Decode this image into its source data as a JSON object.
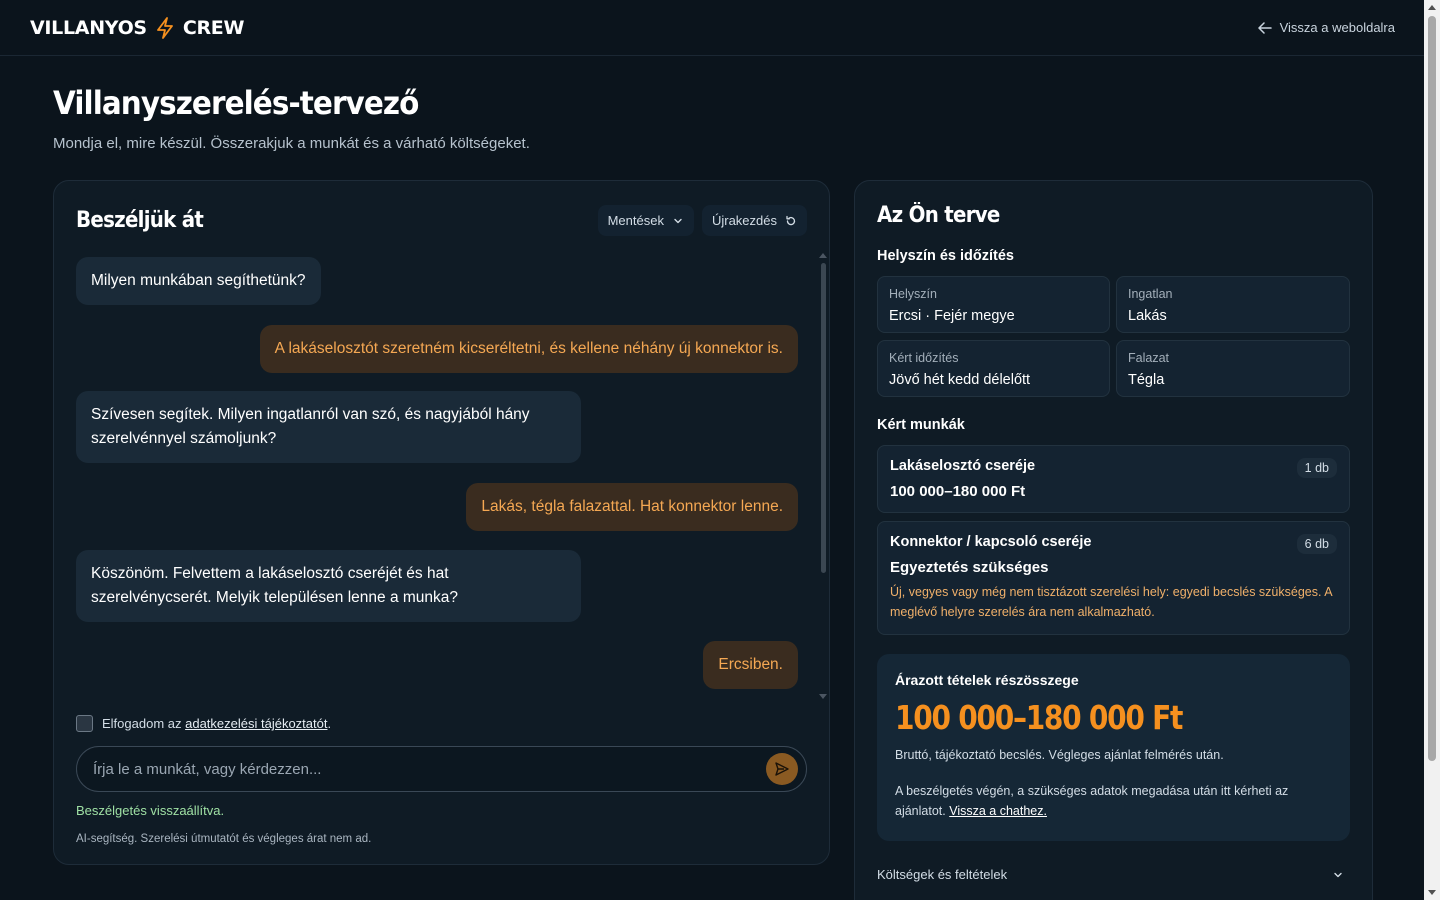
{
  "header": {
    "logo_left": "VILLANYOS",
    "logo_right": "CREW",
    "back_link": "Vissza a weboldalra"
  },
  "page": {
    "title": "Villanyszerelés-tervező",
    "subtitle": "Mondja el, mire készül. Összerakjuk a munkát és a várható költségeket."
  },
  "chat": {
    "title": "Beszéljük át",
    "saves_label": "Mentések",
    "restart_label": "Újrakezdés",
    "messages": [
      {
        "role": "bot",
        "text": "Milyen munkában segíthetünk?"
      },
      {
        "role": "user",
        "text": "A lakáselosztót szeretném kicseréltetni, és kellene néhány új konnektor is."
      },
      {
        "role": "bot",
        "text": "Szívesen segítek. Milyen ingatlanról van szó, és nagyjából hány szerelvénnyel számoljunk?"
      },
      {
        "role": "user",
        "text": "Lakás, tégla falazattal. Hat konnektor lenne."
      },
      {
        "role": "bot",
        "text": "Köszönöm. Felvettem a lakáselosztó cseréjét és hat szerelvénycserét. Melyik településen lenne a munka?"
      },
      {
        "role": "user",
        "text": "Ercsiben."
      }
    ],
    "consent_prefix": "Elfogadom az ",
    "consent_link": "adatkezelési tájékoztatót",
    "consent_suffix": ".",
    "input_placeholder": "Írja le a munkát, vagy kérdezzen...",
    "status": "Beszélgetés visszaállítva.",
    "disclaimer": "AI-segítség. Szerelési útmutatót és végleges árat nem ad."
  },
  "plan": {
    "title": "Az Ön terve",
    "location_section": "Helyszín és időzítés",
    "fields": [
      {
        "label": "Helyszín",
        "value": "Ercsi · Fejér megye"
      },
      {
        "label": "Ingatlan",
        "value": "Lakás"
      },
      {
        "label": "Kért időzítés",
        "value": "Jövő hét kedd délelőtt"
      },
      {
        "label": "Falazat",
        "value": "Tégla"
      }
    ],
    "work_section": "Kért munkák",
    "work_items": [
      {
        "name": "Lakáselosztó cseréje",
        "qty": "1 db",
        "price": "100 000–180 000 Ft"
      },
      {
        "name": "Konnektor / kapcsoló cseréje",
        "qty": "6 db",
        "price": "Egyeztetés szükséges",
        "note": "Új, vegyes vagy még nem tisztázott szerelési hely: egyedi becslés szükséges. A meglévő helyre szerelés ára nem alkalmazható."
      }
    ],
    "summary": {
      "label": "Árazott tételek részösszege",
      "amount": "100 000–180 000 Ft",
      "note": "Bruttó, tájékoztató becslés. Végleges ajánlat felmérés után.",
      "info_text": "A beszélgetés végén, a szükséges adatok megadása után itt kérheti az ajánlatot. ",
      "info_link": "Vissza a chathez."
    },
    "accordion_label": "Költségek és feltételek"
  },
  "colors": {
    "accent": "#f5901f",
    "user_bubble_bg": "#3a2c1f",
    "user_bubble_text": "#f5a853",
    "bot_bubble_bg": "#1a2a38",
    "status_green": "#9fe0a4",
    "background": "#0b141c"
  }
}
